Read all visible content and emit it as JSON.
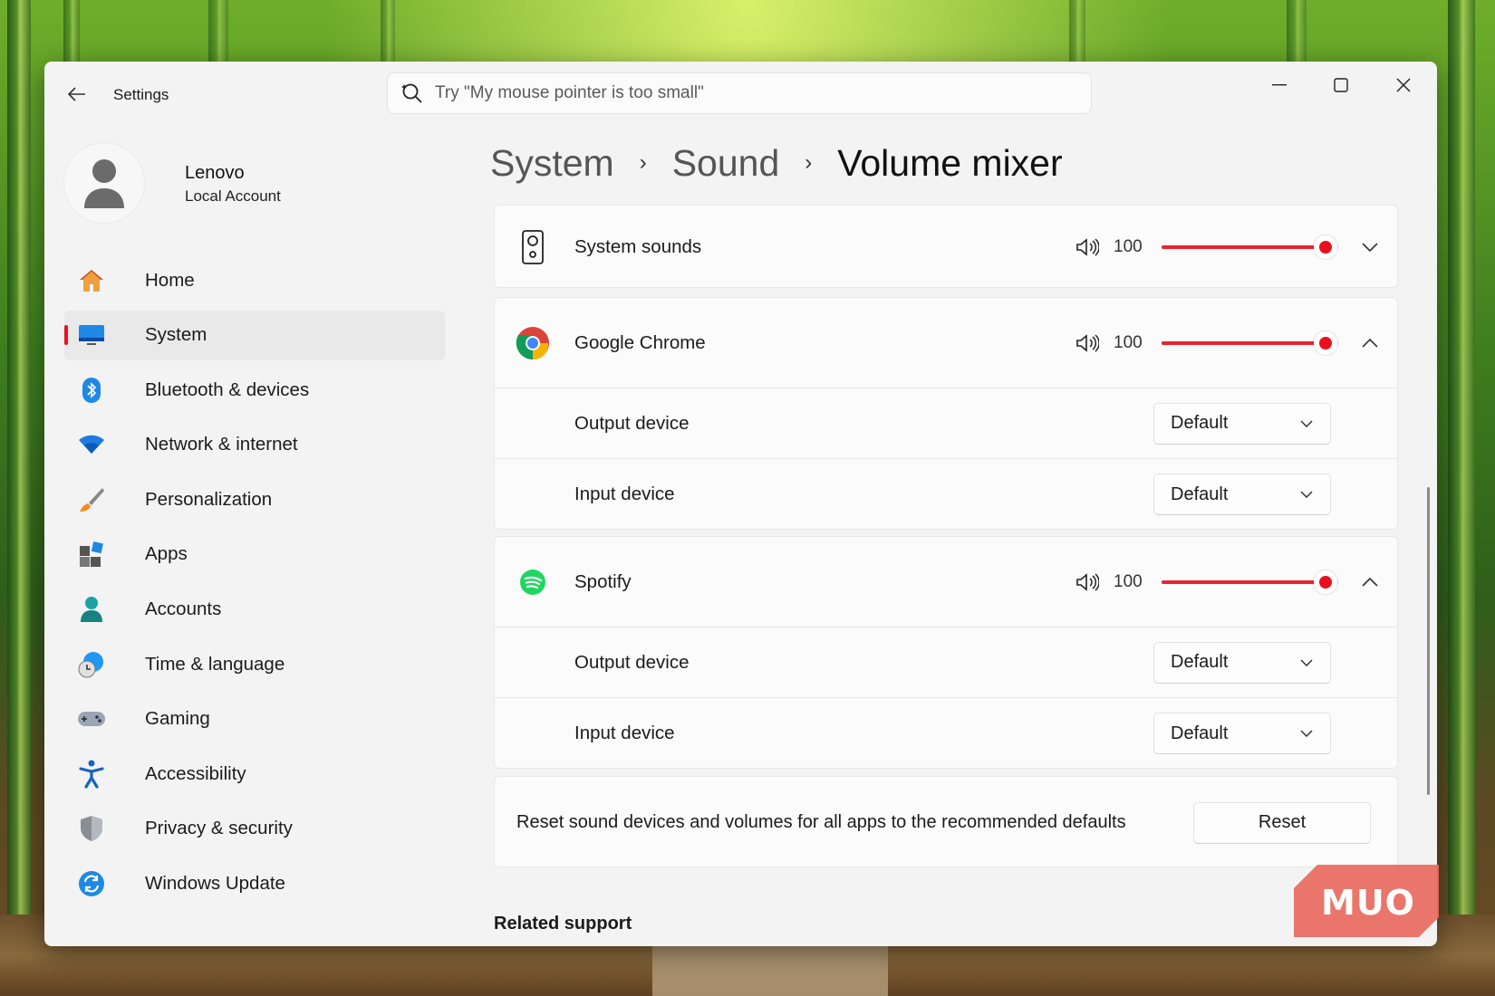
{
  "window": {
    "title": "Settings",
    "search": {
      "placeholder": "Try \"My mouse pointer is too small\""
    }
  },
  "profile": {
    "name": "Lenovo",
    "account_type": "Local Account"
  },
  "sidebar": {
    "items": [
      {
        "label": "Home",
        "icon": "home-icon",
        "active": false
      },
      {
        "label": "System",
        "icon": "system-icon",
        "active": true
      },
      {
        "label": "Bluetooth & devices",
        "icon": "bluetooth-icon",
        "active": false
      },
      {
        "label": "Network & internet",
        "icon": "wifi-icon",
        "active": false
      },
      {
        "label": "Personalization",
        "icon": "brush-icon",
        "active": false
      },
      {
        "label": "Apps",
        "icon": "apps-icon",
        "active": false
      },
      {
        "label": "Accounts",
        "icon": "accounts-icon",
        "active": false
      },
      {
        "label": "Time & language",
        "icon": "globe-clock-icon",
        "active": false
      },
      {
        "label": "Gaming",
        "icon": "gamepad-icon",
        "active": false
      },
      {
        "label": "Accessibility",
        "icon": "accessibility-icon",
        "active": false
      },
      {
        "label": "Privacy & security",
        "icon": "shield-icon",
        "active": false
      },
      {
        "label": "Windows Update",
        "icon": "update-icon",
        "active": false
      }
    ],
    "accent": "#e81123"
  },
  "breadcrumb": {
    "items": [
      "System",
      "Sound",
      "Volume mixer"
    ],
    "separator": "›"
  },
  "mixer": {
    "system_sounds": {
      "label": "System sounds",
      "volume": 100,
      "expanded": false
    },
    "apps": [
      {
        "label": "Google Chrome",
        "volume": 100,
        "expanded": true,
        "output_label": "Output device",
        "output_value": "Default",
        "input_label": "Input device",
        "input_value": "Default"
      },
      {
        "label": "Spotify",
        "volume": 100,
        "expanded": true,
        "output_label": "Output device",
        "output_value": "Default",
        "input_label": "Input device",
        "input_value": "Default"
      }
    ],
    "slider_color": "#e8242f"
  },
  "reset": {
    "text": "Reset sound devices and volumes for all apps to the recommended defaults",
    "button": "Reset"
  },
  "related_support": "Related support",
  "watermark": "MUO"
}
